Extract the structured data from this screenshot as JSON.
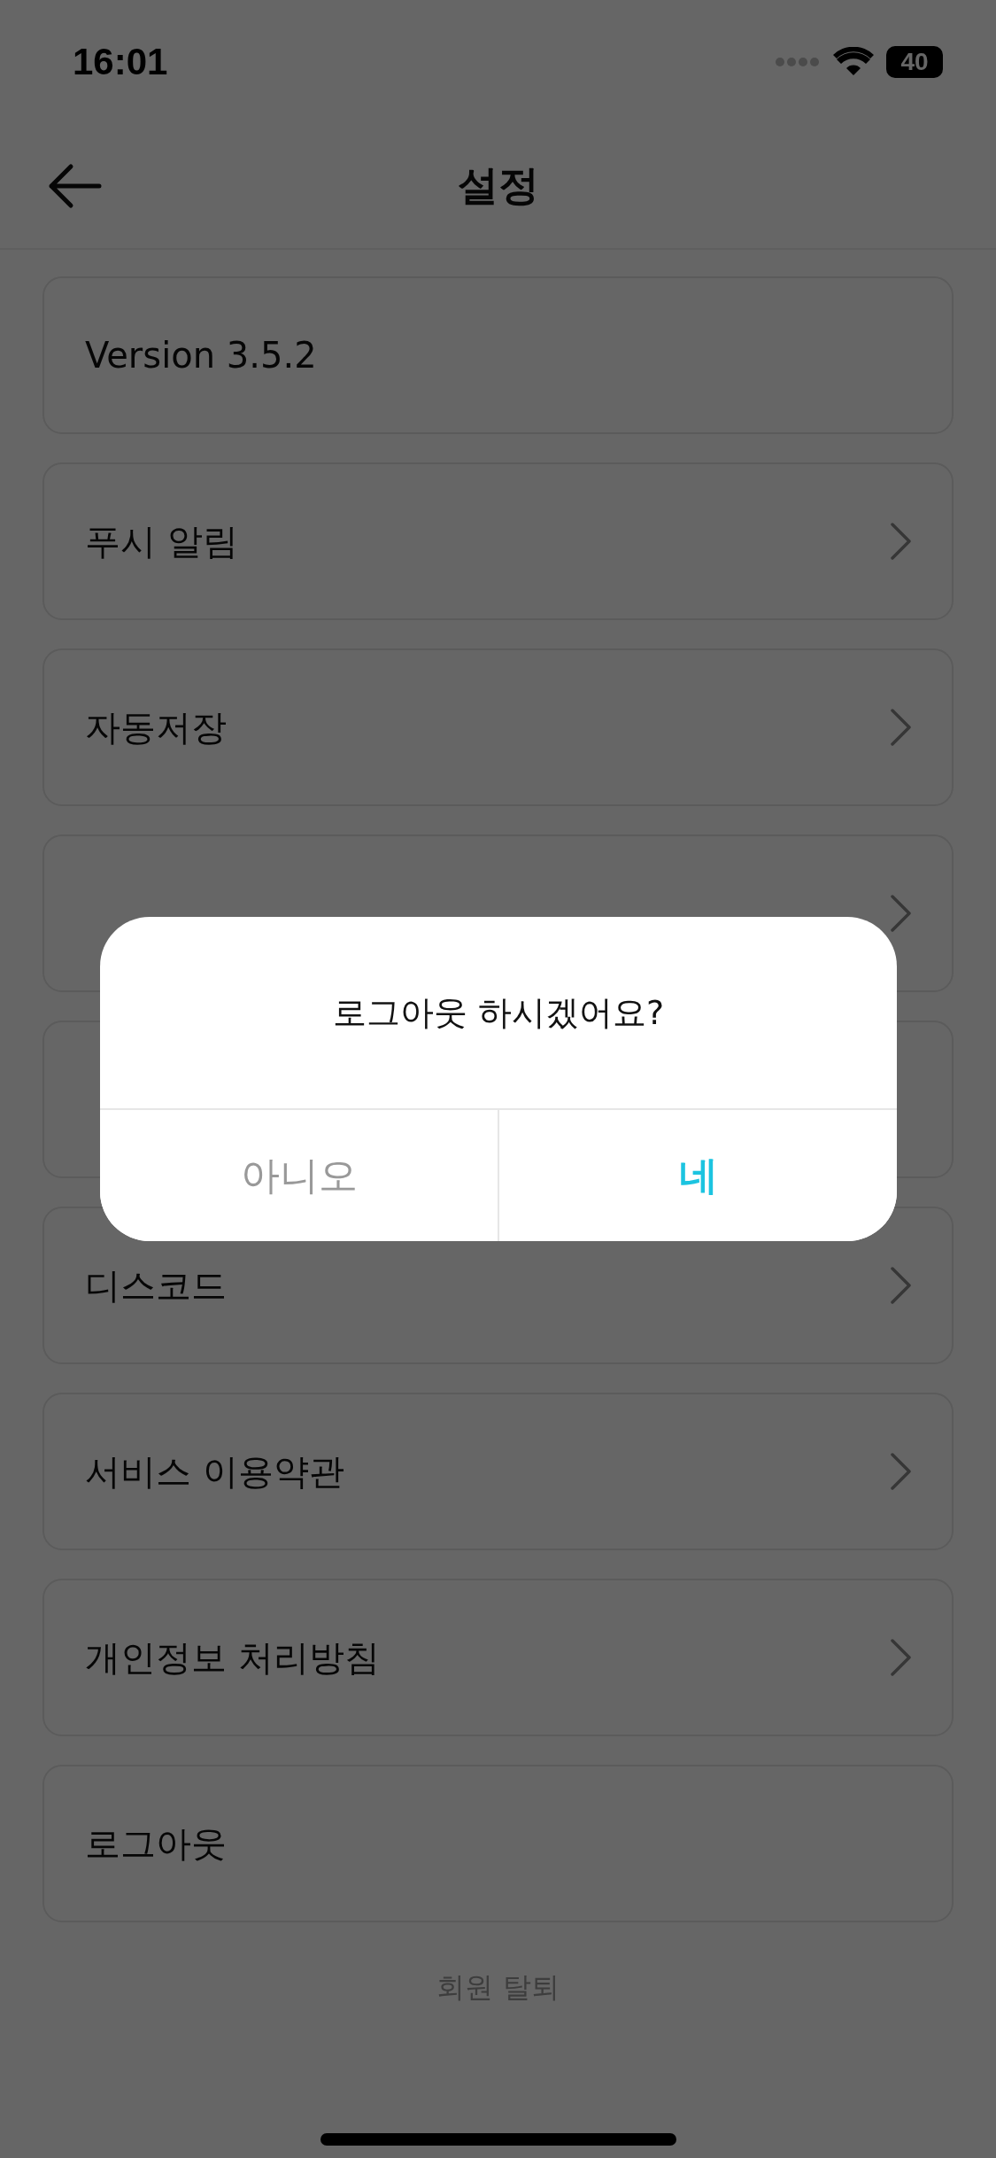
{
  "status_bar": {
    "time": "16:01",
    "battery": "40"
  },
  "nav": {
    "title": "설정"
  },
  "items": [
    {
      "kind": "info",
      "label": "Version 3.5.2"
    },
    {
      "kind": "link",
      "label": "푸시 알림"
    },
    {
      "kind": "link",
      "label": "자동저장"
    },
    {
      "kind": "arrow_only"
    },
    {
      "kind": "blank"
    },
    {
      "kind": "link",
      "label": "디스코드"
    },
    {
      "kind": "link",
      "label": "서비스 이용약관"
    },
    {
      "kind": "link",
      "label": "개인정보 처리방침"
    },
    {
      "kind": "info",
      "label": "로그아웃"
    }
  ],
  "withdraw": "회원 탈퇴",
  "dialog": {
    "message": "로그아웃 하시겠어요?",
    "buttons": [
      {
        "kind": "cancel",
        "label": "아니오"
      },
      {
        "kind": "confirm",
        "label": "네"
      }
    ]
  }
}
